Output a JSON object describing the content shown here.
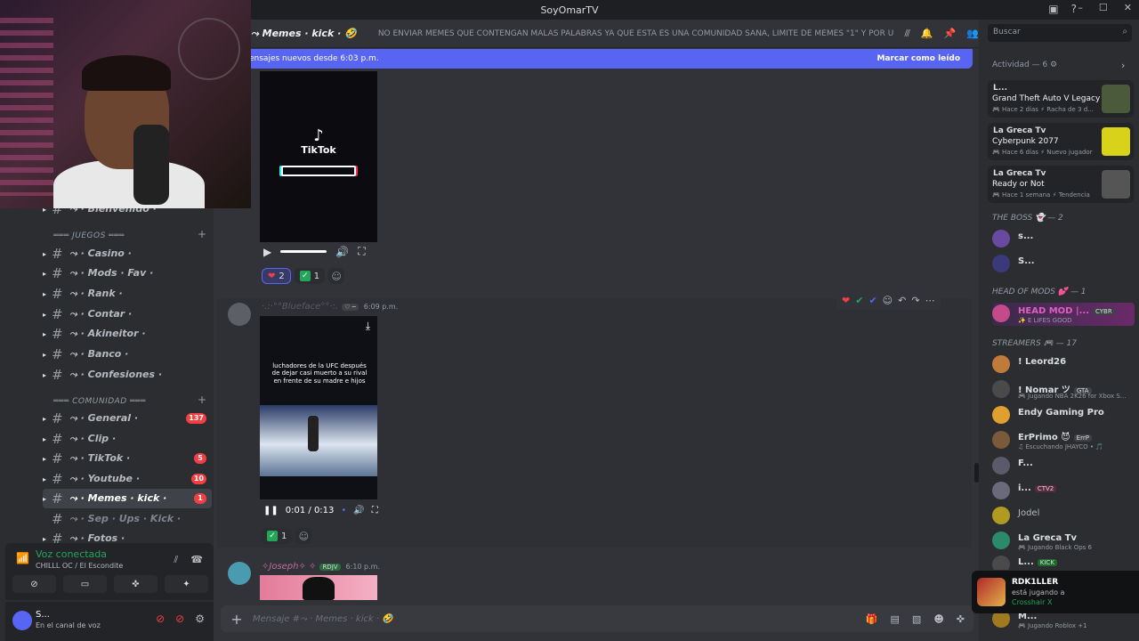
{
  "window": {
    "title": "SoyOmarTV",
    "controls": [
      "–",
      "☐",
      "✕"
    ]
  },
  "sidebar": {
    "categories": [
      {
        "label": "═══ JUEGOS ═══"
      },
      {
        "label": "═══ COMUNIDAD ═══"
      }
    ],
    "channels": [
      {
        "label": "⤳ · Bienvenido · ",
        "badge": ""
      },
      {
        "label": "⤳ · Casino · ",
        "badge": ""
      },
      {
        "label": "⤳ · Mods · Fav · ",
        "badge": ""
      },
      {
        "label": "⤳ · Rank · ",
        "badge": ""
      },
      {
        "label": "⤳ · Contar · ",
        "badge": ""
      },
      {
        "label": "⤳ · Akineitor · ",
        "badge": ""
      },
      {
        "label": "⤳ · Banco · ",
        "badge": ""
      },
      {
        "label": "⤳ · Confesiones · ",
        "badge": ""
      },
      {
        "label": "⤳ · General · ",
        "badge": "137"
      },
      {
        "label": "⤳ · Clip · ",
        "badge": ""
      },
      {
        "label": "⤳ · TikTok · ",
        "badge": "5"
      },
      {
        "label": "⤳ · Youtube · ",
        "badge": "10"
      },
      {
        "label": "⤳ · Memes · kick · ",
        "badge": "1"
      },
      {
        "label": "⤳ · Sep · Ups · Kick · ",
        "badge": ""
      },
      {
        "label": "⤳ · Fotos · ",
        "badge": ""
      }
    ],
    "voice": {
      "status": "Voz conectada",
      "channel": "CHILLL OC / El Escondite"
    },
    "user": {
      "name": "S...",
      "status": "En el canal de voz"
    }
  },
  "main": {
    "channel_name": "⤳ Memes · kick · 🤣",
    "topic": "NO ENVIAR MEMES QUE CONTENGAN MALAS PALABRAS YA QUE ESTA ES UNA COMUNIDAD SANA, LIMITE DE MEMES \"1\" Y POR ULTIMO EL ...",
    "new_messages": "ensajes nuevos desde 6:03 p.m.",
    "mark_read": "Marcar como leído",
    "video1": {
      "logo_text": "TikTok"
    },
    "reactions1": [
      {
        "emoji": "❤",
        "count": "2"
      },
      {
        "emoji": "✓",
        "count": "1"
      }
    ],
    "msg2": {
      "author": "·.:·°°Blueface°°·:.",
      "tag": "♡ ─",
      "time": "6:09 p.m.",
      "caption": "luchadores de la UFC después de dejar casi muerto a su rival en frente de su madre e hijos",
      "video_time": "0:01 / 0:13"
    },
    "reactions2": [
      {
        "emoji": "✓",
        "count": "1"
      }
    ],
    "msg3": {
      "author": "✧Joseph✧ ✧",
      "tag": "RDJV",
      "time": "6:10 p.m."
    },
    "composer_placeholder": "Mensaje #⤳ · Memes · kick · 🤣"
  },
  "right": {
    "search_placeholder": "Buscar",
    "activity_header": "Actividad — 6 ⚙",
    "activities": [
      {
        "who": "L...",
        "game": "Grand Theft Auto V Legacy",
        "meta": "🎮 Hace 2 días  ⚡ Racha de 3 d...",
        "thumb": "#4a5a3a"
      },
      {
        "who": "La Greca Tv",
        "game": "Cyberpunk 2077",
        "meta": "🎮 Hace 6 días  ⚡ Nuevo jugador",
        "thumb": "#d8d21a"
      },
      {
        "who": "La Greca Tv",
        "game": "Ready or Not",
        "meta": "🎮 Hace 1 semana  ⚡ Tendencia",
        "thumb": "#555555"
      }
    ],
    "groups": [
      {
        "label": "THE BOSS 👻 — 2"
      },
      {
        "label": "HEAD OF MODS 💕 — 1"
      },
      {
        "label": "STREAMERS 🎮 — 17"
      }
    ],
    "members": [
      {
        "name": "s...",
        "sub": "",
        "tag": "",
        "color": "#6a4aa0"
      },
      {
        "name": "S...",
        "sub": "",
        "tag": "",
        "color": "#3a3a7a"
      },
      {
        "name": "HEAD MOD |...",
        "sub": "✨ E LIFES GOOD",
        "tag": "CYBR",
        "color": "#c44a8a"
      },
      {
        "name": "! Leord26",
        "sub": "",
        "tag": "",
        "color": "#c07a3a"
      },
      {
        "name": "! Nomar ツ",
        "sub": "🎮 Jugando NBA 2K26 for Xbox S...",
        "tag": "GTA",
        "color": "#4a4a4a"
      },
      {
        "name": "Endy Gaming Pro",
        "sub": "",
        "tag": "",
        "color": "#e0a030"
      },
      {
        "name": "ErPrimo 😈",
        "sub": "♫ Escuchando JHAYCO • 🎵",
        "tag": "ErrP",
        "color": "#7a5a3a"
      },
      {
        "name": "F...",
        "sub": "",
        "tag": "",
        "color": "#5a5a6a"
      },
      {
        "name": "i...",
        "sub": "",
        "tag": "CTV2",
        "color": "#6a6a7a"
      },
      {
        "name": "Jodel",
        "sub": "",
        "tag": "",
        "color": "#b09a20"
      },
      {
        "name": "La Greca Tv",
        "sub": "🎮 Jugando Black Ops 6",
        "tag": "",
        "color": "#2a8a6a"
      },
      {
        "name": "L...",
        "sub": "",
        "tag": "KICK",
        "color": "#4a4a4a"
      },
      {
        "name": "M...",
        "sub": "🎮 Jugando Roblox +1",
        "tag": "",
        "color": "#a07a20"
      }
    ],
    "toast": {
      "name": "RDK1LLER",
      "status": "está jugando a",
      "game": "Crosshair X"
    }
  },
  "colors": {
    "accent": "#5865f2",
    "online": "#23a55a",
    "danger": "#f23f43"
  }
}
